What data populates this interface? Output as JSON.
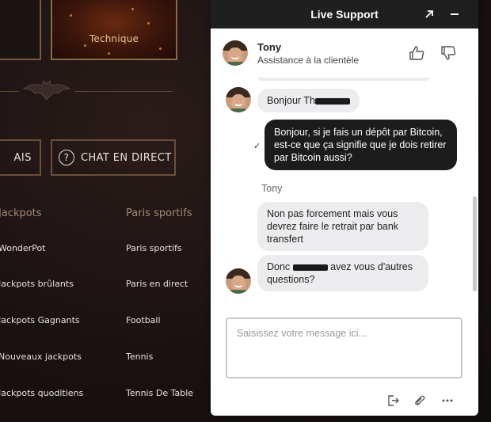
{
  "background": {
    "tile_label": "Technique",
    "btn_left_label": "AIS",
    "btn_chat_label": "CHAT EN DIRECT",
    "btn_chat_icon": "question-circle-icon",
    "columns": [
      {
        "heading": "Jackpots",
        "items": [
          "WonderPot",
          "Jackpots brûlants",
          "Jackpots Gagnants",
          "Nouveaux jackpots",
          "Jackpots quoditiens"
        ]
      },
      {
        "heading": "Paris sportifs",
        "items": [
          "Paris sportifs",
          "Paris en direct",
          "Football",
          "Tennis",
          "Tennis De Table"
        ]
      }
    ]
  },
  "chat": {
    "title": "Live Support",
    "expand_icon": "arrow-up-right-icon",
    "minimize_icon": "minus-icon",
    "agent": {
      "name": "Tony",
      "role": "Assistance à la clientèle"
    },
    "rating_icons": [
      "thumbs-up-icon",
      "thumbs-down-icon"
    ],
    "messages": [
      {
        "from": "agent",
        "text_before": "Bonjour Th",
        "text_after": ""
      },
      {
        "from": "user",
        "text": "Bonjour, si je fais un dépôt par Bitcoin, est-ce que ça signifie que je dois retirer par Bitcoin aussi?",
        "status": "✓"
      },
      {
        "from": "agent",
        "sender": "Tony",
        "text": "Non pas forcement mais vous devrez faire le retrait par bank transfert"
      },
      {
        "from": "agent",
        "text_before": "Donc ",
        "text_after": " avez vous d'autres questions?"
      }
    ],
    "input_placeholder": "Saisissez votre message ici...",
    "footer_icons": [
      "exit-icon",
      "attachment-icon",
      "more-icon"
    ]
  },
  "colors": {
    "page_bg": "#1a1212",
    "header_bg": "#1f1f1f",
    "user_bubble": "#1c1c1c",
    "agent_bubble": "#ececef",
    "gold": "#8a6a44"
  }
}
